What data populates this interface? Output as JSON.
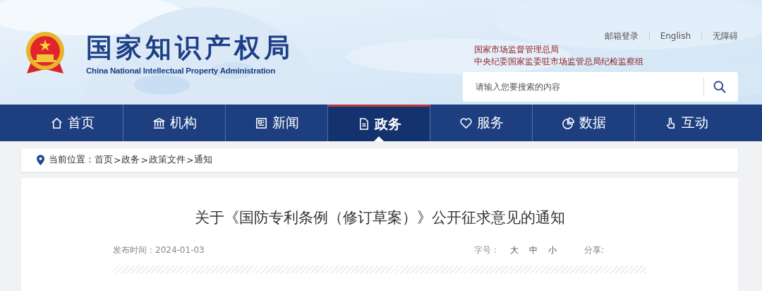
{
  "header": {
    "site_title": "国家知识产权局",
    "site_subtitle": "China National Intellectual Property Administration",
    "top_links": [
      "邮箱登录",
      "English",
      "无障碍"
    ],
    "parent_orgs": [
      "国家市场监督管理总局",
      "中央纪委国家监委驻市场监管总局纪检监察组"
    ],
    "search": {
      "placeholder": "请输入您要搜索的内容"
    }
  },
  "nav": [
    {
      "label": "首页",
      "kind": "home",
      "selected": false
    },
    {
      "label": "机构",
      "kind": "org",
      "selected": false
    },
    {
      "label": "新闻",
      "kind": "news",
      "selected": false
    },
    {
      "label": "政务",
      "kind": "gov",
      "selected": true
    },
    {
      "label": "服务",
      "kind": "service",
      "selected": false
    },
    {
      "label": "数据",
      "kind": "data",
      "selected": false
    },
    {
      "label": "互动",
      "kind": "interact",
      "selected": false
    }
  ],
  "breadcrumb": {
    "prefix": "当前位置：",
    "separator": ">",
    "items": [
      "首页",
      "政务",
      "政策文件",
      "通知"
    ]
  },
  "article": {
    "title": "关于《国防专利条例（修订草案）》公开征求意见的通知",
    "published": "发布时间：2024-01-03",
    "font_size_label": "字号：",
    "font_sizes": [
      "大",
      "中",
      "小"
    ],
    "share_label": "分享:"
  }
}
